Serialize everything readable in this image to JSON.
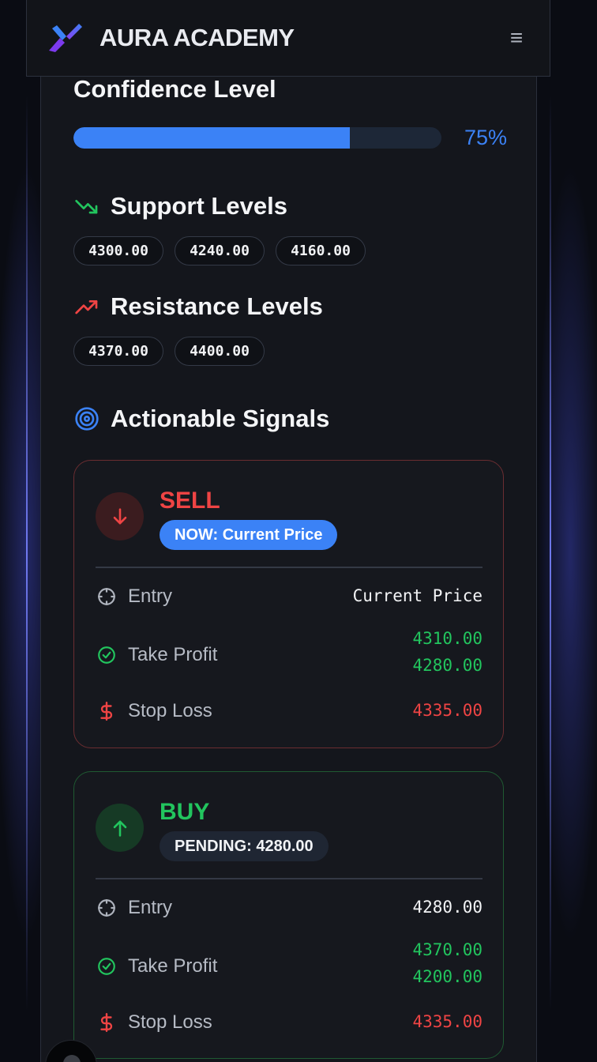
{
  "header": {
    "brand": "AURA ACADEMY",
    "logo_icon": "aura-x-logo",
    "menu_icon": "≡"
  },
  "confidence": {
    "title": "Confidence Level",
    "percent_label": "75%",
    "value": 0.75,
    "fill_color": "#3b82f6"
  },
  "support": {
    "title": "Support Levels",
    "icon": "trending-down-icon",
    "levels": [
      "4300.00",
      "4240.00",
      "4160.00"
    ]
  },
  "resistance": {
    "title": "Resistance Levels",
    "icon": "trending-up-icon",
    "levels": [
      "4370.00",
      "4400.00"
    ]
  },
  "signals_section": {
    "title": "Actionable Signals",
    "icon": "target-icon"
  },
  "signals": [
    {
      "type": "SELL",
      "status": "NOW: Current Price",
      "entry_label": "Entry",
      "entry_value": "Current Price",
      "tp_label": "Take Profit",
      "tp_values": [
        "4310.00",
        "4280.00"
      ],
      "sl_label": "Stop Loss",
      "sl_value": "4335.00",
      "accent": "#ef4444"
    },
    {
      "type": "BUY",
      "status": "PENDING: 4280.00",
      "entry_label": "Entry",
      "entry_value": "4280.00",
      "tp_label": "Take Profit",
      "tp_values": [
        "4370.00",
        "4200.00"
      ],
      "sl_label": "Stop Loss",
      "sl_value": "4335.00",
      "accent": "#22c55e"
    }
  ]
}
